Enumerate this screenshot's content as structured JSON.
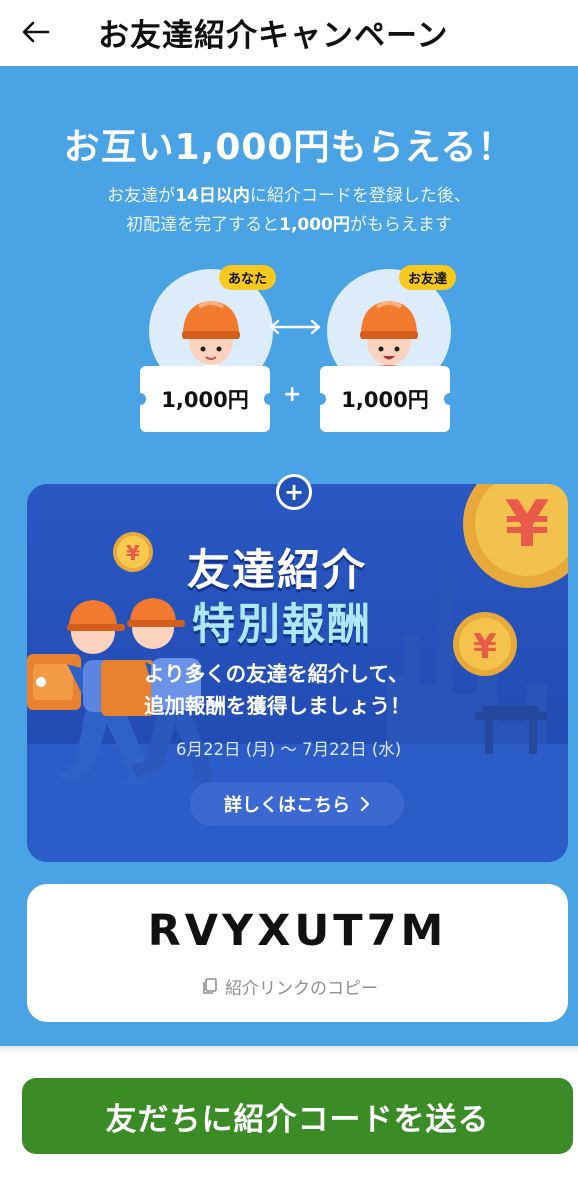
{
  "header": {
    "title": "お友達紹介キャンペーン"
  },
  "hero": {
    "title": "お互い1,000円もらえる！",
    "desc_line1_pre": "お友達が",
    "desc_line1_bold": "14日以内",
    "desc_line1_post": "に紹介コードを登録した後、",
    "desc_line2_pre": "初配達を完了すると",
    "desc_line2_bold": "1,000円",
    "desc_line2_post": "がもらえます",
    "you_badge": "あなた",
    "friend_badge": "お友達",
    "you_reward": "1,000円",
    "friend_reward": "1,000円",
    "plus": "+"
  },
  "promo": {
    "plus": "+",
    "title_line1": "友達紹介",
    "title_line2": "特別報酬",
    "subtitle_line1": "より多くの友達を紹介して、",
    "subtitle_line2": "追加報酬を獲得しましょう！",
    "dates": "6月22日 (月) 〜 7月22日 (水)",
    "details_button": "詳しくはこちら"
  },
  "referral": {
    "code": "RVYXUT7M",
    "copy_label": "紹介リンクのコピー"
  },
  "footer": {
    "send_button": "友だちに紹介コードを送る"
  },
  "colors": {
    "background": "#4aa3e4",
    "promo_bg": "#2350b9",
    "badge": "#f7c91e",
    "cta": "#3b8b27",
    "helmet": "#f27a2e"
  },
  "icons": {
    "back": "arrow-left-icon",
    "swap": "double-arrow-icon",
    "copy": "copy-icon",
    "chevron": "chevron-right-icon",
    "coin": "yen-coin-icon"
  }
}
